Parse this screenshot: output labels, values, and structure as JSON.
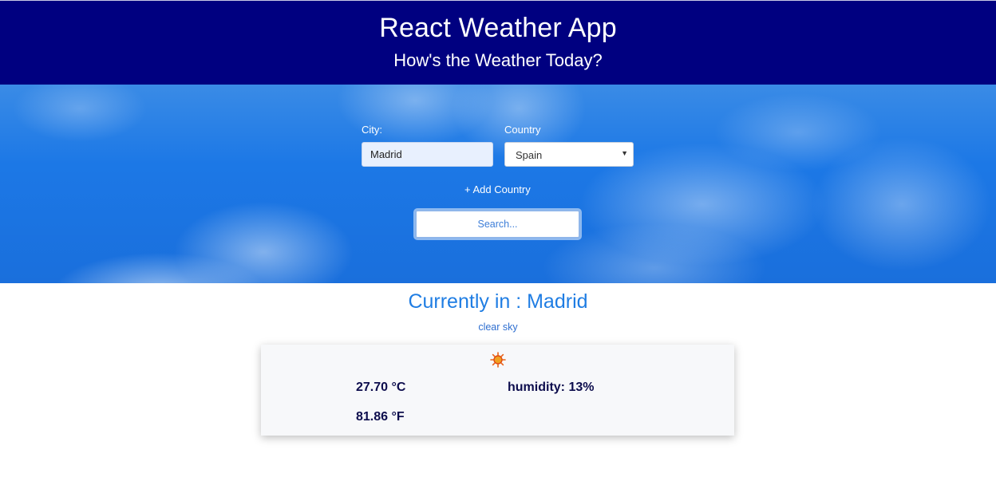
{
  "header": {
    "title": "React Weather App",
    "subtitle": "How's the Weather Today?",
    "background_color": "#000080"
  },
  "form": {
    "city_label": "City:",
    "city_value": "Madrid",
    "country_label": "Country",
    "country_selected": "Spain",
    "add_country_label": "+ Add Country",
    "search_label": "Search..."
  },
  "current": {
    "heading": "Currently in : Madrid",
    "description": "clear sky"
  },
  "weather": {
    "icon": "sun-icon",
    "celsius": "27.70 °C",
    "fahrenheit": "81.86 °F",
    "humidity": "humidity: 13%"
  },
  "colors": {
    "accent": "#1f7de3",
    "value_text": "#0d0d4d"
  }
}
